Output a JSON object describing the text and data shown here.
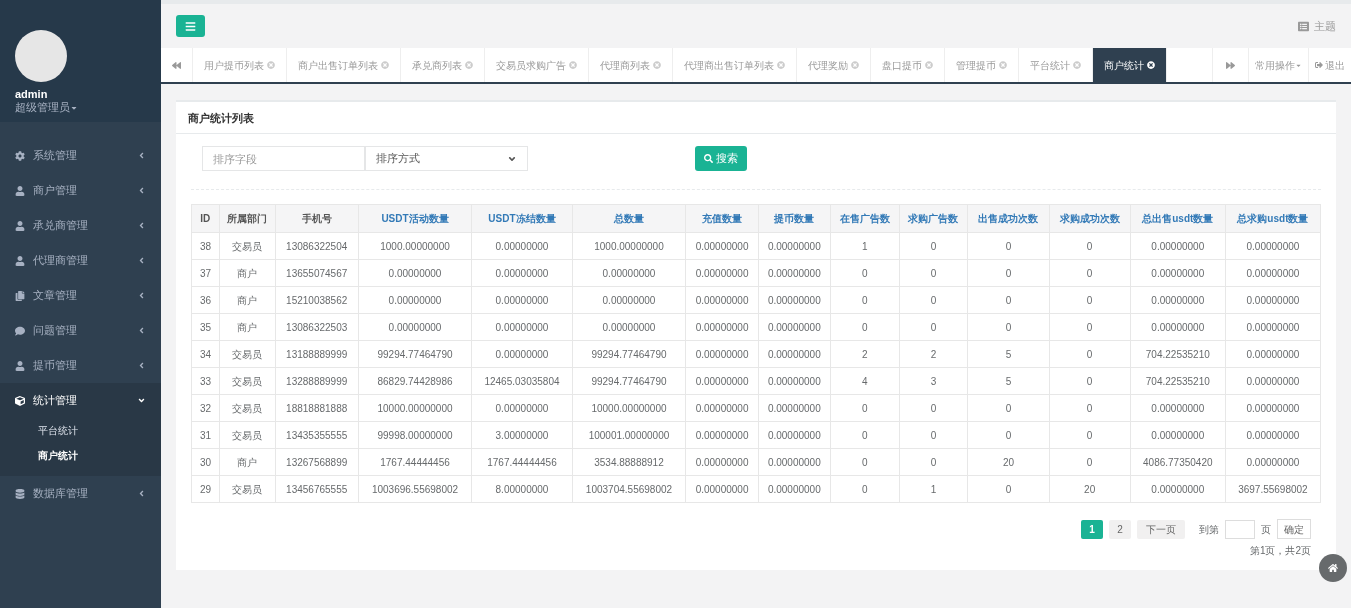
{
  "sidebar": {
    "user": {
      "name": "admin",
      "role": "超级管理员"
    },
    "items": [
      {
        "label": "系统管理",
        "expanded": false
      },
      {
        "label": "商户管理",
        "expanded": false
      },
      {
        "label": "承兑商管理",
        "expanded": false
      },
      {
        "label": "代理商管理",
        "expanded": false
      },
      {
        "label": "文章管理",
        "expanded": false
      },
      {
        "label": "问题管理",
        "expanded": false
      },
      {
        "label": "提币管理",
        "expanded": false
      },
      {
        "label": "统计管理",
        "expanded": true,
        "children": [
          {
            "label": "平台统计",
            "selected": false
          },
          {
            "label": "商户统计",
            "selected": true
          }
        ]
      },
      {
        "label": "数据库管理",
        "expanded": false
      }
    ]
  },
  "topbar": {
    "theme": "主题"
  },
  "tabs": [
    {
      "label": "用户提币列表",
      "selected": false
    },
    {
      "label": "商户出售订单列表",
      "selected": false
    },
    {
      "label": "承兑商列表",
      "selected": false
    },
    {
      "label": "交易员求购广告",
      "selected": false
    },
    {
      "label": "代理商列表",
      "selected": false
    },
    {
      "label": "代理商出售订单列表",
      "selected": false
    },
    {
      "label": "代理奖励",
      "selected": false
    },
    {
      "label": "盘口提币",
      "selected": false
    },
    {
      "label": "管理提币",
      "selected": false
    },
    {
      "label": "平台统计",
      "selected": false
    },
    {
      "label": "商户统计",
      "selected": true
    }
  ],
  "tab_actions": {
    "menu": "常用操作",
    "logout": "退出"
  },
  "panel": {
    "title": "商户统计列表",
    "filters": {
      "sort_field": {
        "placeholder": "排序字段"
      },
      "sort_order": {
        "value": "排序方式"
      },
      "search_button": "搜索"
    },
    "table": {
      "columns": [
        {
          "label": "ID",
          "sortable": false
        },
        {
          "label": "所属部门",
          "sortable": false
        },
        {
          "label": "手机号",
          "sortable": false
        },
        {
          "label": "USDT活动数量",
          "sortable": true
        },
        {
          "label": "USDT冻结数量",
          "sortable": true
        },
        {
          "label": "总数量",
          "sortable": true
        },
        {
          "label": "充值数量",
          "sortable": true
        },
        {
          "label": "提币数量",
          "sortable": true
        },
        {
          "label": "在售广告数",
          "sortable": true
        },
        {
          "label": "求购广告数",
          "sortable": true
        },
        {
          "label": "出售成功次数",
          "sortable": true
        },
        {
          "label": "求购成功次数",
          "sortable": true
        },
        {
          "label": "总出售usdt数量",
          "sortable": true
        },
        {
          "label": "总求购usdt数量",
          "sortable": true
        }
      ],
      "rows": [
        [
          "38",
          "交易员",
          "13086322504",
          "1000.00000000",
          "0.00000000",
          "1000.00000000",
          "0.00000000",
          "0.00000000",
          "1",
          "0",
          "0",
          "0",
          "0.00000000",
          "0.00000000"
        ],
        [
          "37",
          "商户",
          "13655074567",
          "0.00000000",
          "0.00000000",
          "0.00000000",
          "0.00000000",
          "0.00000000",
          "0",
          "0",
          "0",
          "0",
          "0.00000000",
          "0.00000000"
        ],
        [
          "36",
          "商户",
          "15210038562",
          "0.00000000",
          "0.00000000",
          "0.00000000",
          "0.00000000",
          "0.00000000",
          "0",
          "0",
          "0",
          "0",
          "0.00000000",
          "0.00000000"
        ],
        [
          "35",
          "商户",
          "13086322503",
          "0.00000000",
          "0.00000000",
          "0.00000000",
          "0.00000000",
          "0.00000000",
          "0",
          "0",
          "0",
          "0",
          "0.00000000",
          "0.00000000"
        ],
        [
          "34",
          "交易员",
          "13188889999",
          "99294.77464790",
          "0.00000000",
          "99294.77464790",
          "0.00000000",
          "0.00000000",
          "2",
          "2",
          "5",
          "0",
          "704.22535210",
          "0.00000000"
        ],
        [
          "33",
          "交易员",
          "13288889999",
          "86829.74428986",
          "12465.03035804",
          "99294.77464790",
          "0.00000000",
          "0.00000000",
          "4",
          "3",
          "5",
          "0",
          "704.22535210",
          "0.00000000"
        ],
        [
          "32",
          "交易员",
          "18818881888",
          "10000.00000000",
          "0.00000000",
          "10000.00000000",
          "0.00000000",
          "0.00000000",
          "0",
          "0",
          "0",
          "0",
          "0.00000000",
          "0.00000000"
        ],
        [
          "31",
          "交易员",
          "13435355555",
          "99998.00000000",
          "3.00000000",
          "100001.00000000",
          "0.00000000",
          "0.00000000",
          "0",
          "0",
          "0",
          "0",
          "0.00000000",
          "0.00000000"
        ],
        [
          "30",
          "商户",
          "13267568899",
          "1767.44444456",
          "1767.44444456",
          "3534.88888912",
          "0.00000000",
          "0.00000000",
          "0",
          "0",
          "20",
          "0",
          "4086.77350420",
          "0.00000000"
        ],
        [
          "29",
          "交易员",
          "13456765555",
          "1003696.55698002",
          "8.00000000",
          "1003704.55698002",
          "0.00000000",
          "0.00000000",
          "0",
          "1",
          "0",
          "20",
          "0.00000000",
          "3697.55698002"
        ]
      ]
    },
    "pagination": {
      "pages": [
        {
          "label": "1",
          "selected": true
        },
        {
          "label": "2",
          "selected": false
        }
      ],
      "next": "下一页",
      "goto_prefix": "到第",
      "goto_suffix": "页",
      "confirm": "确定",
      "summary": "第1页，共2页"
    }
  }
}
